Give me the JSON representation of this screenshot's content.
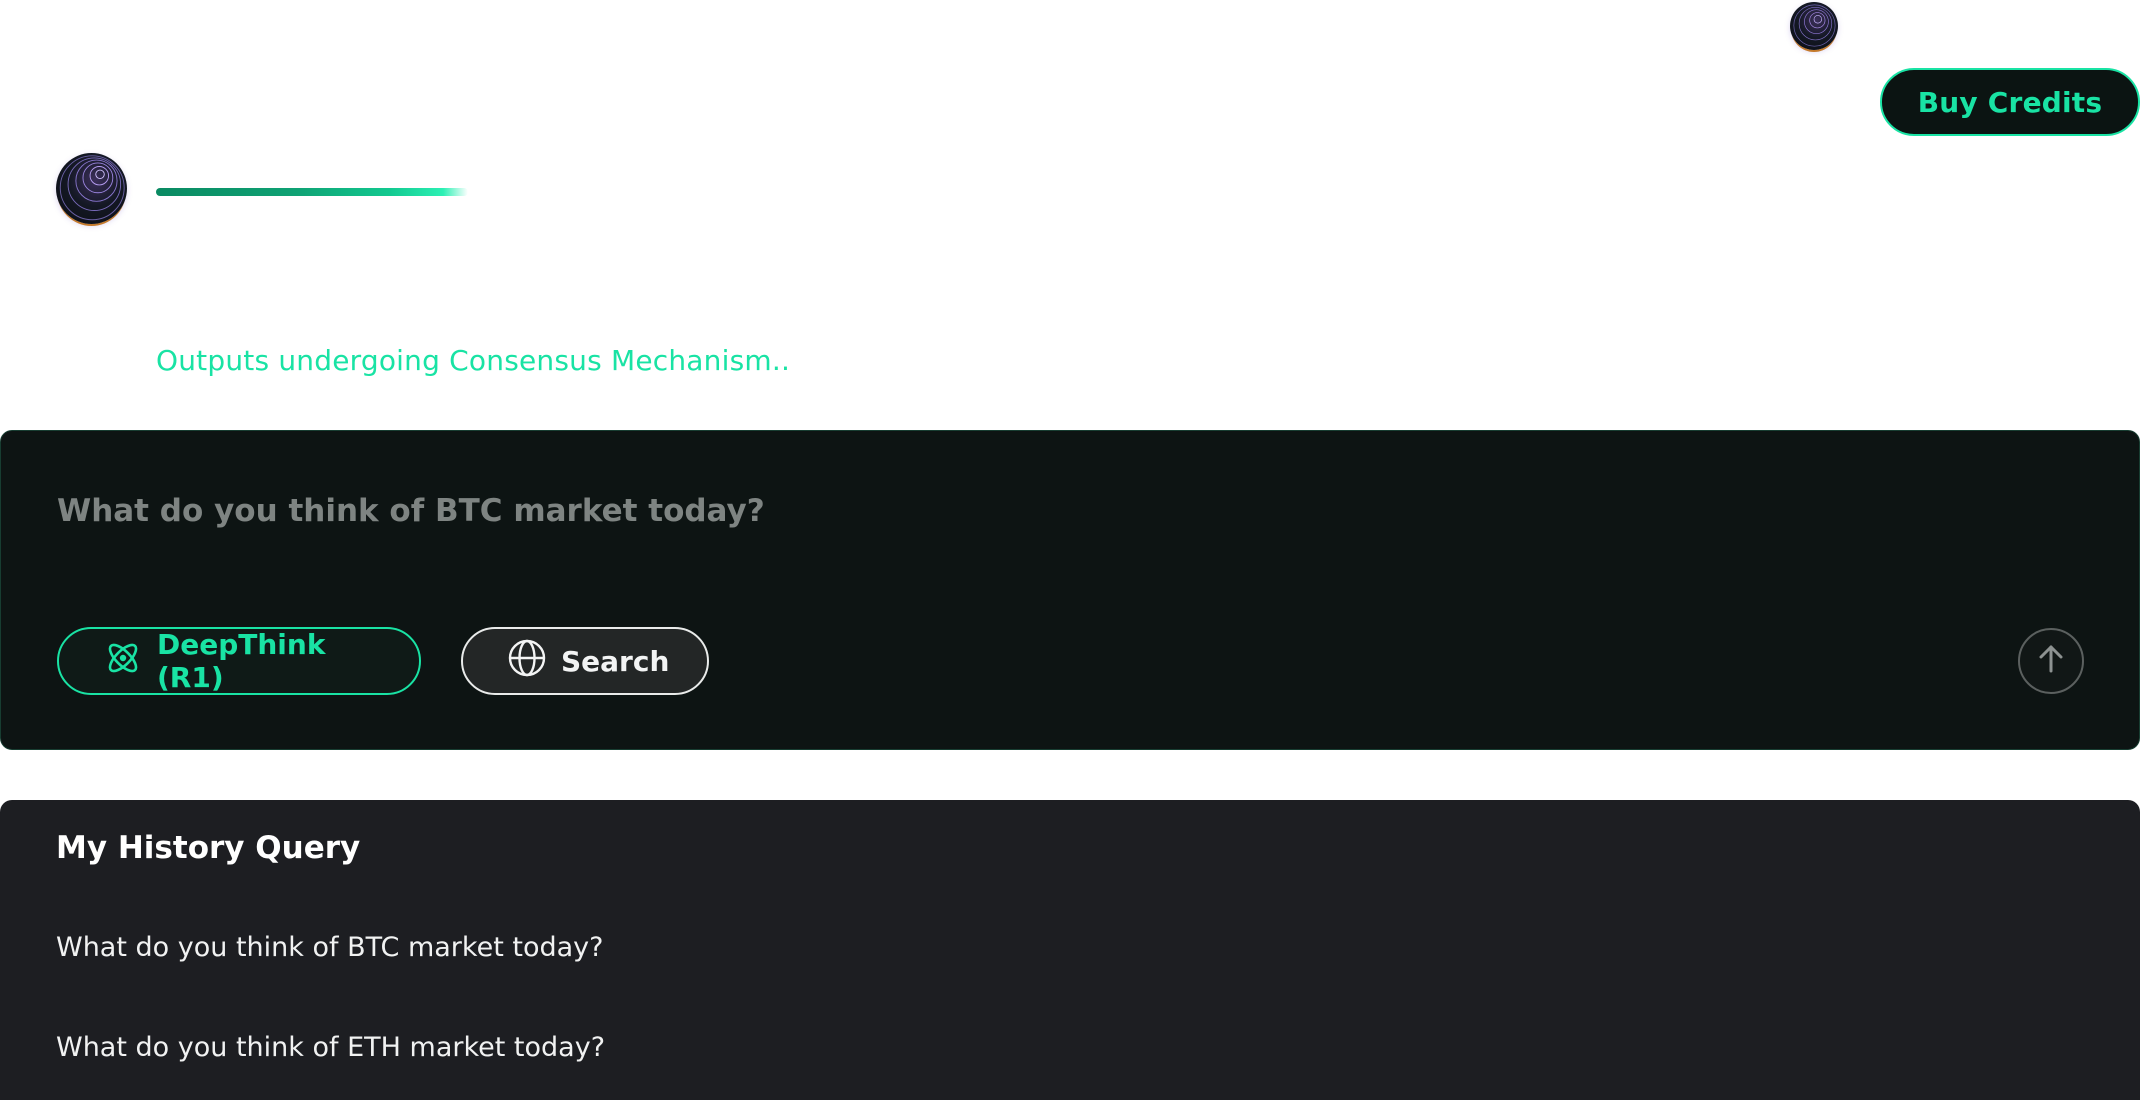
{
  "header": {
    "buy_credits_label": "Buy Credits"
  },
  "response": {
    "status_text": "Outputs undergoing Consensus Mechanism..",
    "progress_fraction": 0.9
  },
  "composer": {
    "placeholder": "What do you think of BTC market today?",
    "value": "",
    "deepthink_label": "DeepThink (R1)",
    "search_label": "Search",
    "icons": {
      "deepthink": "atom-icon",
      "search": "globe-icon",
      "send": "arrow-up-icon"
    }
  },
  "history": {
    "title": "My History Query",
    "items": [
      "What do you think of BTC market today?",
      "What do you think of ETH market today?"
    ]
  },
  "colors": {
    "accent": "#19e3a4",
    "composer_bg": "#0d1413",
    "history_bg": "#1d1e22"
  }
}
